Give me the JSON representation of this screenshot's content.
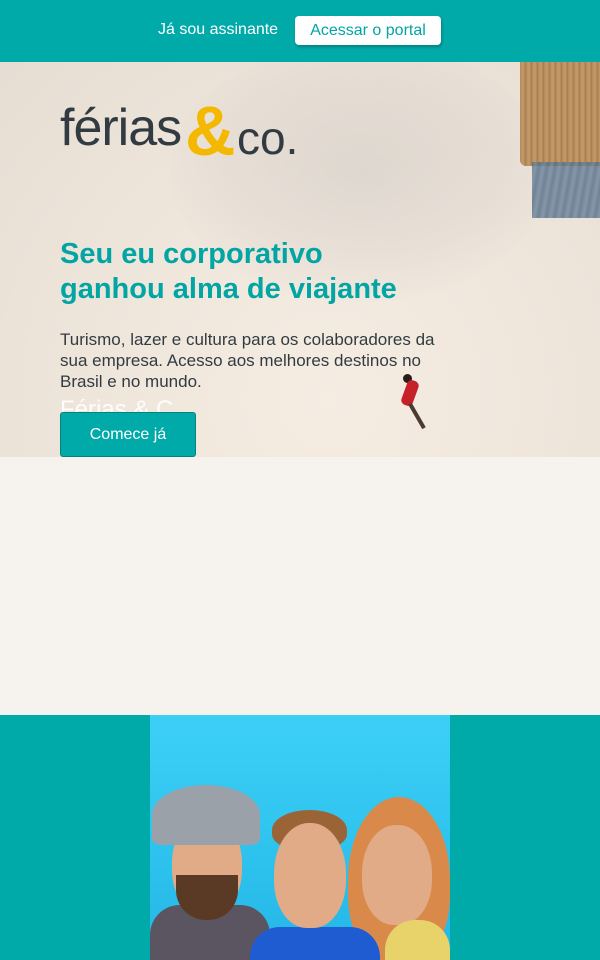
{
  "topbar": {
    "subscriber_text": "Já sou assinante",
    "portal_button": "Acessar o portal"
  },
  "brand": {
    "logo_word": "férias",
    "logo_amp": "&",
    "logo_suffix": "co.",
    "colors": {
      "teal": "#00aaa9",
      "yellow": "#f5b800",
      "dark": "#333b42"
    }
  },
  "hero": {
    "headline_line1": "Seu eu corporativo",
    "headline_line2": "ganhou alma de viajante",
    "description": "Turismo, lazer e cultura para os colaboradores da sua empresa. Acesso aos melhores destinos no Brasil e no mundo.",
    "ghost_text": "Férias & C",
    "cta_button": "Comece já"
  },
  "family_image": {
    "alt": "family-photo"
  }
}
